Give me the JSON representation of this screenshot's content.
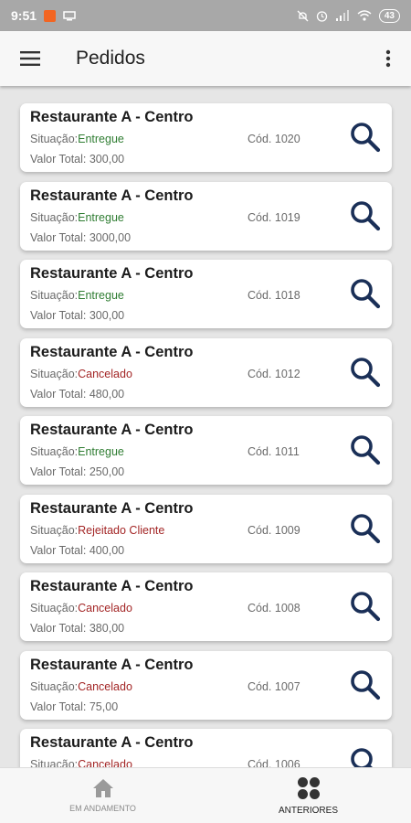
{
  "status_bar": {
    "time": "9:51",
    "battery": "43"
  },
  "app_bar": {
    "title": "Pedidos"
  },
  "labels": {
    "status_prefix": "Situação:",
    "value_prefix": "Valor Total: ",
    "code_prefix": "Cód. "
  },
  "colors": {
    "status_green": "#2f7d32",
    "status_red": "#a32626",
    "search_icon": "#1a2f57"
  },
  "orders": [
    {
      "restaurant": "Restaurante A - Centro",
      "status": "Entregue",
      "status_color": "green",
      "code": "1020",
      "total": "300,00"
    },
    {
      "restaurant": "Restaurante A - Centro",
      "status": "Entregue",
      "status_color": "green",
      "code": "1019",
      "total": "3000,00"
    },
    {
      "restaurant": "Restaurante A - Centro",
      "status": "Entregue",
      "status_color": "green",
      "code": "1018",
      "total": "300,00"
    },
    {
      "restaurant": "Restaurante A - Centro",
      "status": "Cancelado",
      "status_color": "red",
      "code": "1012",
      "total": "480,00"
    },
    {
      "restaurant": "Restaurante A - Centro",
      "status": "Entregue",
      "status_color": "green",
      "code": "1011",
      "total": "250,00"
    },
    {
      "restaurant": "Restaurante A - Centro",
      "status": "Rejeitado Cliente",
      "status_color": "red",
      "code": "1009",
      "total": "400,00"
    },
    {
      "restaurant": "Restaurante A - Centro",
      "status": "Cancelado",
      "status_color": "red",
      "code": "1008",
      "total": "380,00"
    },
    {
      "restaurant": "Restaurante A - Centro",
      "status": "Cancelado",
      "status_color": "red",
      "code": "1007",
      "total": "75,00"
    },
    {
      "restaurant": "Restaurante A - Centro",
      "status": "Cancelado",
      "status_color": "red",
      "code": "1006",
      "total": ""
    }
  ],
  "bottom_nav": {
    "items": [
      {
        "label": "EM ANDAMENTO",
        "icon": "home-icon",
        "active": false
      },
      {
        "label": "ANTERIORES",
        "icon": "apps-grid-icon",
        "active": true
      }
    ]
  }
}
